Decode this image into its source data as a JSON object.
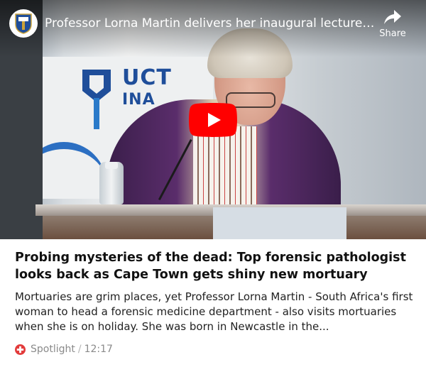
{
  "video": {
    "title": "Professor Lorna Martin delivers her inaugural lecture in …",
    "share_label": "Share",
    "channel_icon": "university-crest-icon",
    "play_icon": "youtube-play-icon",
    "background_text_line1": "UCT",
    "background_text_line2": "INA",
    "colors": {
      "play_red": "#ff0000",
      "uct_blue": "#1f4e9a"
    }
  },
  "article": {
    "headline": "Probing mysteries of the dead: Top forensic pathologist looks back as Cape Town gets shiny new mortuary",
    "summary": "Mortuaries are grim places, yet Professor Lorna Martin - South Africa's first woman to head a forensic medicine department - also visits mortuaries when she is on holiday. She was born in Newcastle in the...",
    "source": "Spotlight",
    "separator": "/",
    "time": "12:17",
    "source_icon": "spotlight-cross-icon",
    "colors": {
      "source_red": "#e23b3b"
    }
  }
}
